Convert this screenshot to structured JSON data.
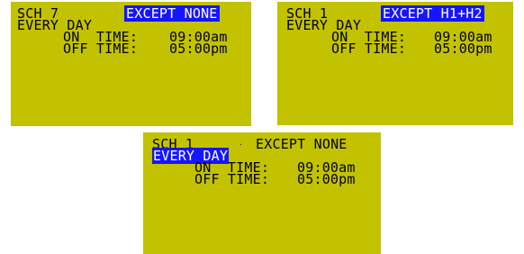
{
  "screens": [
    {
      "schedule": "SCH 7",
      "except": "EXCEPT NONE",
      "days": "EVERY DAY",
      "on_label": "ON  TIME:",
      "on_time": "09:00am",
      "off_label": "OFF TIME:",
      "off_time": "05:00pm",
      "highlight": "except"
    },
    {
      "schedule": "SCH 1",
      "except": "EXCEPT H1+H2",
      "days": "EVERY DAY",
      "on_label": "ON  TIME:",
      "on_time": "09:00am",
      "off_label": "OFF TIME:",
      "off_time": "05:00pm",
      "highlight": "except"
    },
    {
      "schedule": "SCH 1",
      "except": "EXCEPT NONE",
      "days": "EVERY DAY",
      "on_label": "ON  TIME:",
      "on_time": "09:00am",
      "off_label": "OFF TIME:",
      "off_time": "05:00pm",
      "highlight": "days"
    }
  ],
  "colors": {
    "screen_bg": "#c2c200",
    "highlight_bg": "#1515ff",
    "text": "#000000",
    "highlight_text": "#ffffff"
  }
}
